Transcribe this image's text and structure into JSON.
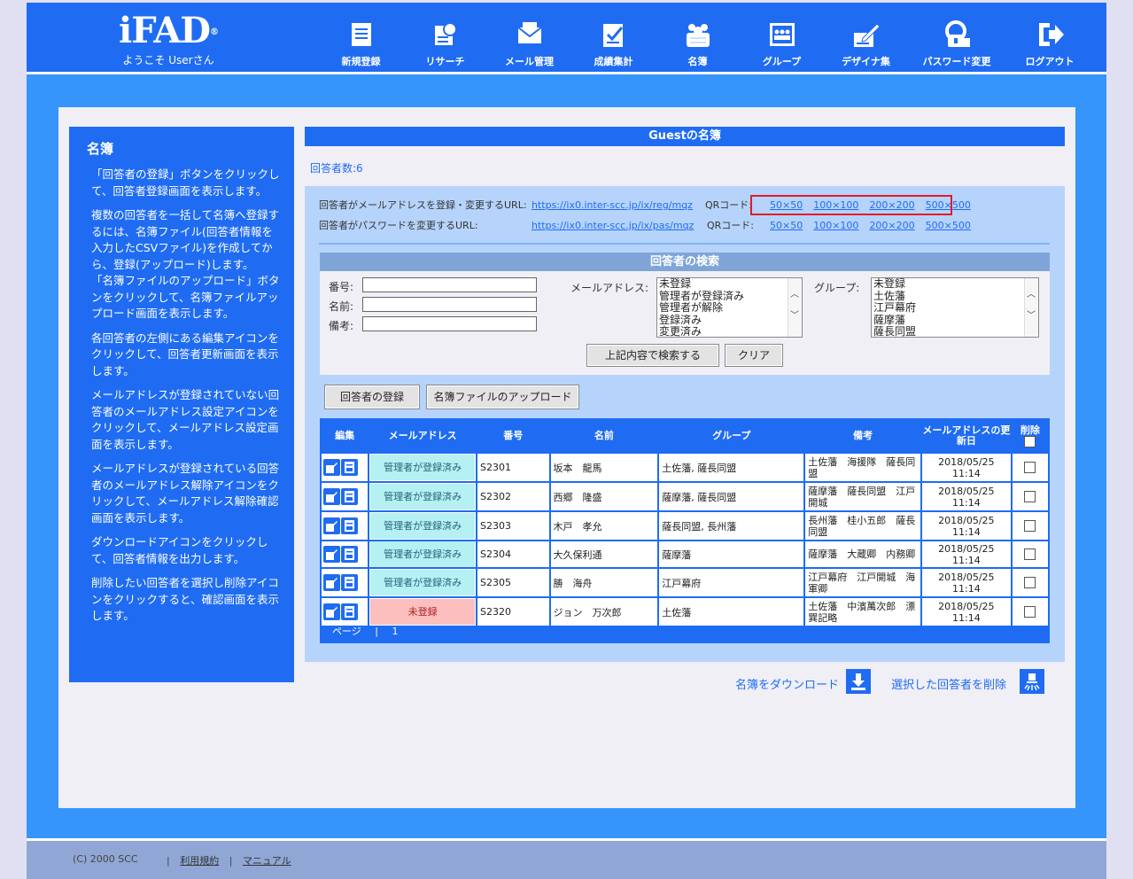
{
  "app": {
    "brand": "iFAD",
    "brand_mark": "®",
    "welcome": "ようこそ Userさん"
  },
  "nav": [
    {
      "label": "新規登録",
      "icon": "new-registration-icon"
    },
    {
      "label": "リサーチ",
      "icon": "research-icon"
    },
    {
      "label": "メール管理",
      "icon": "mail-management-icon"
    },
    {
      "label": "成績集計",
      "icon": "results-tally-icon"
    },
    {
      "label": "名簿",
      "icon": "roster-icon",
      "active": true
    },
    {
      "label": "グループ",
      "icon": "group-icon"
    },
    {
      "label": "デザイナ集",
      "icon": "designer-icon"
    },
    {
      "label": "パスワード変更",
      "icon": "password-change-icon"
    },
    {
      "label": "ログアウト",
      "icon": "logout-icon"
    }
  ],
  "help": {
    "title": "名簿",
    "paragraphs": [
      "「回答者の登録」ボタンをクリックして、回答者登録画面を表示します。",
      "複数の回答者を一括して名簿へ登録するには、名簿ファイル(回答者情報を入力したCSVファイル)を作成してから、登録(アップロード)します。\n「名簿ファイルのアップロード」ボタンをクリックして、名簿ファイルアップロード画面を表示します。",
      "各回答者の左側にある編集アイコンをクリックして、回答者更新画面を表示します。",
      "メールアドレスが登録されていない回答者のメールアドレス設定アイコンをクリックして、メールアドレス設定画面を表示します。",
      "メールアドレスが登録されている回答者のメールアドレス解除アイコンをクリックして、メールアドレス解除確認画面を表示します。",
      "ダウンロードアイコンをクリックして、回答者情報を出力します。",
      "削除したい回答者を選択し削除アイコンをクリックすると、確認画面を表示します。"
    ]
  },
  "main": {
    "title": "Guestの名簿",
    "respondent_count": "回答者数:6"
  },
  "urls": {
    "reg_label": "回答者がメールアドレスを登録・変更するURL:",
    "reg_url": "https://ix0.inter-scc.jp/ix/reg/mqz",
    "pas_label": "回答者がパスワードを変更するURL:",
    "pas_url": "https://ix0.inter-scc.jp/ix/pas/mqz",
    "qr_label": "QRコード:",
    "qr_sizes": [
      "50×50",
      "100×100",
      "200×200",
      "500×500"
    ]
  },
  "search": {
    "header": "回答者の検索",
    "number_label": "番号:",
    "name_label": "名前:",
    "note_label": "備考:",
    "mail_label": "メールアドレス:",
    "mail_options": [
      "未登録",
      "管理者が登録済み",
      "管理者が解除",
      "登録済み",
      "変更済み"
    ],
    "group_label": "グループ:",
    "group_options": [
      "未登録",
      "土佐藩",
      "江戸幕府",
      "薩摩藩",
      "薩長同盟"
    ],
    "search_button": "上記内容で検索する",
    "clear_button": "クリア"
  },
  "actions": {
    "register_button": "回答者の登録",
    "upload_button": "名簿ファイルのアップロード",
    "download_link": "名簿をダウンロード",
    "delete_link": "選択した回答者を削除"
  },
  "table": {
    "headers": {
      "edit": "編集",
      "mail": "メールアドレス",
      "number": "番号",
      "name": "名前",
      "group": "グループ",
      "note": "備考",
      "updated": "メールアドレスの更新日",
      "delete": "削除"
    },
    "rows": [
      {
        "mail": "管理者が登録済み",
        "mail_status": "registered",
        "number": "S2301",
        "name": "坂本　龍馬",
        "group": "土佐藩, 薩長同盟",
        "note": "土佐藩　海援隊　薩長同盟",
        "updated": "2018/05/25 11:14"
      },
      {
        "mail": "管理者が登録済み",
        "mail_status": "registered",
        "number": "S2302",
        "name": "西郷　隆盛",
        "group": "薩摩藩, 薩長同盟",
        "note": "薩摩藩　薩長同盟　江戸開城",
        "updated": "2018/05/25 11:14"
      },
      {
        "mail": "管理者が登録済み",
        "mail_status": "registered",
        "number": "S2303",
        "name": "木戸　孝允",
        "group": "薩長同盟, 長州藩",
        "note": "長州藩　桂小五郎　薩長同盟",
        "updated": "2018/05/25 11:14"
      },
      {
        "mail": "管理者が登録済み",
        "mail_status": "registered",
        "number": "S2304",
        "name": "大久保利通",
        "group": "薩摩藩",
        "note": "薩摩藩　大蔵卿　内務卿",
        "updated": "2018/05/25 11:14"
      },
      {
        "mail": "管理者が登録済み",
        "mail_status": "registered",
        "number": "S2305",
        "name": "勝　海舟",
        "group": "江戸幕府",
        "note": "江戸幕府　江戸開城　海軍卿",
        "updated": "2018/05/25 11:14"
      },
      {
        "mail": "未登録",
        "mail_status": "unregistered",
        "number": "S2320",
        "name": "ジョン　万次郎",
        "group": "土佐藩",
        "note": "土佐藩　中濱萬次郎　漂巽記略",
        "updated": "2018/05/25 11:14"
      }
    ],
    "pager_label": "ページ",
    "pager_sep": "|",
    "pager_current": "1"
  },
  "footer": {
    "copyright": "(C) 2000 SCC",
    "sep": "|",
    "terms": "利用規約",
    "manual": "マニュアル"
  },
  "colors": {
    "header_blue": "#1f6cf3",
    "panel_blue": "#b6d4fb",
    "registered_badge": "#b5f0f3",
    "unregistered_badge": "#fdbebe",
    "qr_highlight": "#e01b2c"
  }
}
